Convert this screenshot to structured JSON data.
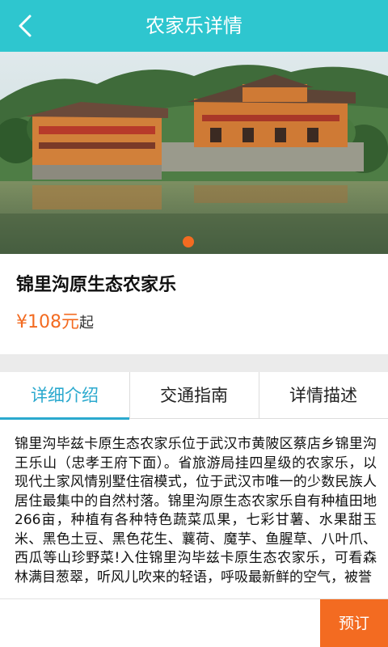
{
  "header": {
    "title": "农家乐详情",
    "back_icon": "chevron-left-icon"
  },
  "hero": {
    "image_subject": "lakeside farmhouse",
    "active_slide": 1,
    "slide_count": 1,
    "indicator_color": "#f36b21"
  },
  "detail": {
    "name": "锦里沟原生态农家乐",
    "price_value": "¥108元",
    "price_suffix": "起"
  },
  "tabs": [
    {
      "label": "详细介绍",
      "active": true
    },
    {
      "label": "交通指南",
      "active": false
    },
    {
      "label": "详情描述",
      "active": false
    }
  ],
  "description": "锦里沟毕兹卡原生态农家乐位于武汉市黄陂区蔡店乡锦里沟王乐山（忠孝王府下面）。省旅游局挂四星级的农家乐，以现代土家风情别墅住宿模式，位于武汉市唯一的少数民族人居住最集中的自然村落。锦里沟原生态农家乐自有种植田地266亩，种植有各种特色蔬菜瓜果，七彩甘薯、水果甜玉米、黑色土豆、黑色花生、蘘荷、魔芋、鱼腥草、八叶爪、西瓜等山珍野菜!入住锦里沟毕兹卡原生态农家乐，可看森林满目葱翠，听风儿吹来的轻语，呼吸最新鲜的空气，被誉",
  "actions": {
    "book_label": "预订"
  },
  "colors": {
    "header_bg": "#2ec6cf",
    "accent": "#2ba9ce",
    "price": "#f36b21",
    "book_button": "#f36b21"
  }
}
